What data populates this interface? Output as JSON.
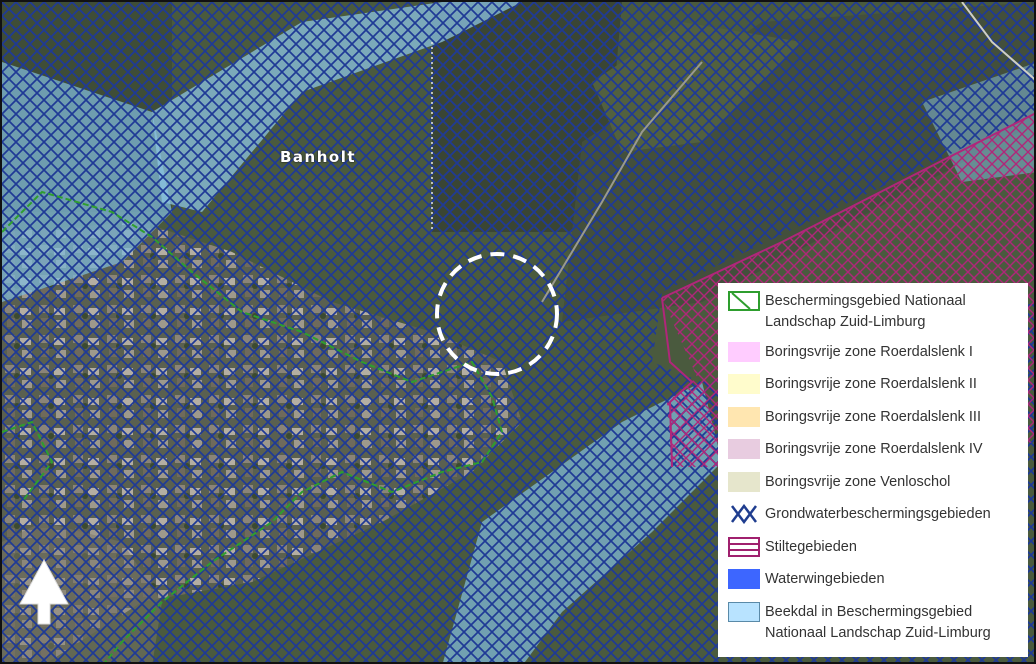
{
  "map": {
    "place_label": "Banholt",
    "north_arrow_icon": "north-arrow-icon",
    "location_marker_icon": "dashed-circle-location-icon"
  },
  "legend": {
    "items": [
      {
        "label": "Beschermingsgebied Nationaal Landschap Zuid-Limburg",
        "icon": "green-hatch-outline-icon",
        "color": "#2e9e2e"
      },
      {
        "label": "Boringsvrije zone Roerdalslenk I",
        "icon": "pink-square-icon",
        "color": "#ffccff"
      },
      {
        "label": "Boringsvrije zone Roerdalslenk II",
        "icon": "light-yellow-square-icon",
        "color": "#fffccc"
      },
      {
        "label": "Boringsvrije zone Roerdalslenk III",
        "icon": "light-orange-square-icon",
        "color": "#ffe6b0"
      },
      {
        "label": "Boringsvrije zone Roerdalslenk IV",
        "icon": "light-purple-square-icon",
        "color": "#e8cce0"
      },
      {
        "label": "Boringsvrije zone Venloschol",
        "icon": "beige-square-icon",
        "color": "#e6e6cc"
      },
      {
        "label": "Grondwaterbeschermingsgebieden",
        "icon": "blue-crosshatch-icon",
        "color": "#1f3d8f"
      },
      {
        "label": "Stiltegebieden",
        "icon": "magenta-hatch-icon",
        "color": "#a0206e"
      },
      {
        "label": "Waterwingebieden",
        "icon": "blue-square-icon",
        "color": "#3d66ff"
      },
      {
        "label": "Beekdal in Beschermingsgebied Nationaal Landschap Zuid-Limburg",
        "icon": "light-blue-square-icon",
        "color": "#b8e3ff"
      }
    ]
  }
}
